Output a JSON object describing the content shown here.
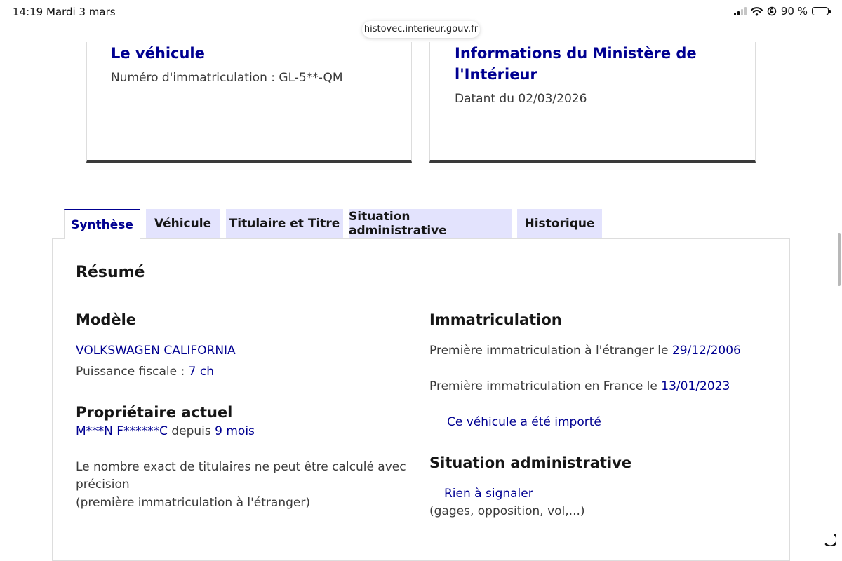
{
  "status_bar": {
    "time": "14:19",
    "date": "Mardi 3 mars",
    "battery": "90 %",
    "battery_level": 0.9
  },
  "browser": {
    "url": "histovec.interieur.gouv.fr"
  },
  "cards": {
    "vehicle": {
      "title": "Le véhicule",
      "plate_text": "Numéro d'immatriculation : GL-5**-QM"
    },
    "ministry": {
      "title_line1": "Informations du Ministère de",
      "title_line2": "l'Intérieur",
      "date_text": "Datant du 02/03/2026"
    }
  },
  "tabs": [
    {
      "label": "Synthèse",
      "active": true
    },
    {
      "label": "Véhicule",
      "active": false
    },
    {
      "label": "Titulaire et Titre",
      "active": false
    },
    {
      "label": "Situation administrative",
      "active": false
    },
    {
      "label": "Historique",
      "active": false
    }
  ],
  "summary": {
    "heading": "Résumé",
    "model": {
      "heading": "Modèle",
      "name": "VOLKSWAGEN CALIFORNIA",
      "power_label": "Puissance fiscale : ",
      "power_value": "7 ch"
    },
    "owner": {
      "heading": "Propriétaire actuel",
      "name": "M***N F******C",
      "since_label": " depuis ",
      "since_value": "9 mois",
      "note_line1": "Le nombre exact de titulaires ne peut être calculé avec",
      "note_line2": "précision",
      "note_line3": "(première immatriculation à l'étranger)"
    },
    "registration": {
      "heading": "Immatriculation",
      "foreign_label": "Première immatriculation à l'étranger le ",
      "foreign_date": "29/12/2006",
      "france_label": "Première immatriculation en France le ",
      "france_date": "13/01/2023",
      "imported": "Ce véhicule a été importé"
    },
    "admin": {
      "heading": "Situation administrative",
      "status": "Rien à signaler",
      "detail": "(gages, opposition, vol,...)"
    }
  },
  "colors": {
    "primary": "#000091",
    "tab_bg": "#e3e3fd",
    "text": "#3a3a3a",
    "heading": "#161616"
  }
}
